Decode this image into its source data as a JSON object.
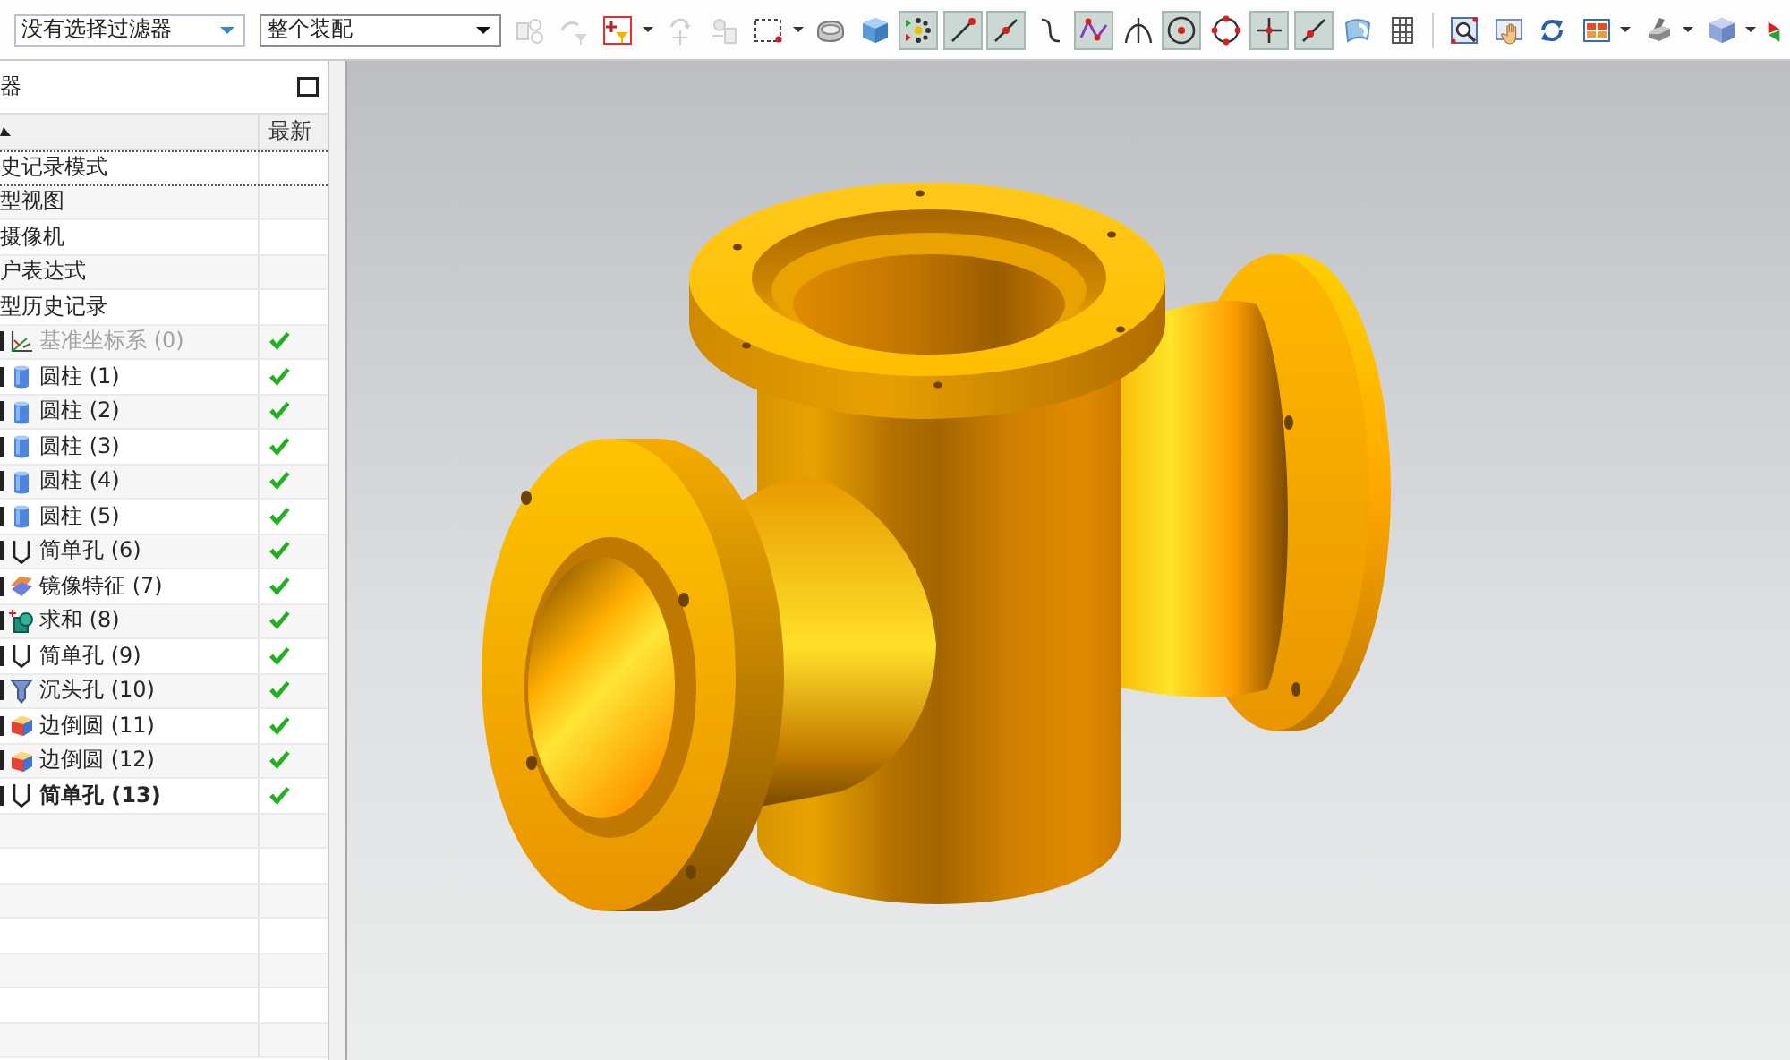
{
  "toolbar": {
    "filter_dropdown": {
      "value": "没有选择过滤器"
    },
    "scope_dropdown": {
      "value": "整个装配"
    },
    "groups": [
      {
        "buttons": [
          {
            "kind": "assembly",
            "on": false,
            "disabled": true,
            "menu": false
          },
          {
            "kind": "move_filter",
            "on": false,
            "disabled": true,
            "menu": false
          },
          {
            "kind": "add_filter",
            "on": false,
            "disabled": false,
            "menu": true
          },
          {
            "kind": "rotate_axis",
            "on": false,
            "disabled": true,
            "menu": false
          },
          {
            "kind": "component",
            "on": false,
            "disabled": true,
            "menu": false
          },
          {
            "kind": "box_select",
            "on": false,
            "disabled": false,
            "menu": true
          },
          {
            "kind": "solid",
            "on": false,
            "disabled": false,
            "menu": false
          },
          {
            "kind": "cube",
            "on": false,
            "disabled": false,
            "menu": false
          },
          {
            "kind": "snap_points",
            "on": true,
            "disabled": false,
            "menu": false
          },
          {
            "kind": "end_point",
            "on": true,
            "disabled": false,
            "menu": false
          },
          {
            "kind": "mid_point",
            "on": true,
            "disabled": false,
            "menu": false
          },
          {
            "kind": "curve",
            "on": false,
            "disabled": false,
            "menu": false
          },
          {
            "kind": "polyline",
            "on": true,
            "disabled": false,
            "menu": false
          },
          {
            "kind": "intersection",
            "on": false,
            "disabled": false,
            "menu": false
          },
          {
            "kind": "arc_center",
            "on": true,
            "disabled": false,
            "menu": false
          },
          {
            "kind": "quadrant",
            "on": false,
            "disabled": false,
            "menu": false
          },
          {
            "kind": "cross_point",
            "on": true,
            "disabled": false,
            "menu": false
          },
          {
            "kind": "point_on_line",
            "on": true,
            "disabled": false,
            "menu": false
          },
          {
            "kind": "surface",
            "on": false,
            "disabled": false,
            "menu": false
          },
          {
            "kind": "grid",
            "on": false,
            "disabled": false,
            "menu": false
          }
        ]
      },
      {
        "buttons": [
          {
            "kind": "zoom_area",
            "on": false,
            "disabled": false,
            "menu": false
          },
          {
            "kind": "pan",
            "on": false,
            "disabled": false,
            "menu": false
          },
          {
            "kind": "rotate",
            "on": false,
            "disabled": false,
            "menu": false
          },
          {
            "kind": "view_layout",
            "on": false,
            "disabled": false,
            "menu": true
          },
          {
            "kind": "render_style",
            "on": false,
            "disabled": false,
            "menu": true
          },
          {
            "kind": "view_cube",
            "on": false,
            "disabled": false,
            "menu": true
          },
          {
            "kind": "triad",
            "on": false,
            "disabled": false,
            "menu": false
          }
        ]
      }
    ]
  },
  "navigator": {
    "title": "器",
    "columns": [
      {
        "sorted": true
      },
      {
        "label": "最新",
        "sorted": false
      }
    ],
    "tree": [
      {
        "label": "史记录模式",
        "focused": true
      },
      {
        "label": "型视图",
        "focused": false
      },
      {
        "label": "摄像机",
        "focused": false
      },
      {
        "label": "户表达式",
        "focused": false
      },
      {
        "label": "型历史记录",
        "focused": false,
        "children": [
          {
            "kind": "datum_csys",
            "label": "基准坐标系 (0)",
            "dimmed": true,
            "current": false,
            "latest": true
          },
          {
            "kind": "cylinder",
            "label": "圆柱 (1)",
            "dimmed": false,
            "current": false,
            "latest": true
          },
          {
            "kind": "cylinder",
            "label": "圆柱 (2)",
            "dimmed": false,
            "current": false,
            "latest": true
          },
          {
            "kind": "cylinder",
            "label": "圆柱 (3)",
            "dimmed": false,
            "current": false,
            "latest": true
          },
          {
            "kind": "cylinder",
            "label": "圆柱 (4)",
            "dimmed": false,
            "current": false,
            "latest": true
          },
          {
            "kind": "cylinder",
            "label": "圆柱 (5)",
            "dimmed": false,
            "current": false,
            "latest": true
          },
          {
            "kind": "simple_hole",
            "label": "简单孔 (6)",
            "dimmed": false,
            "current": false,
            "latest": true
          },
          {
            "kind": "mirror",
            "label": "镜像特征 (7)",
            "dimmed": false,
            "current": false,
            "latest": true
          },
          {
            "kind": "unite",
            "label": "求和 (8)",
            "dimmed": false,
            "current": false,
            "latest": true
          },
          {
            "kind": "simple_hole",
            "label": "简单孔 (9)",
            "dimmed": false,
            "current": false,
            "latest": true
          },
          {
            "kind": "countersink_hole",
            "label": "沉头孔 (10)",
            "dimmed": false,
            "current": false,
            "latest": true
          },
          {
            "kind": "edge_blend",
            "label": "边倒圆 (11)",
            "dimmed": false,
            "current": false,
            "latest": true
          },
          {
            "kind": "edge_blend",
            "label": "边倒圆 (12)",
            "dimmed": false,
            "current": false,
            "latest": true
          },
          {
            "kind": "simple_hole",
            "label": "简单孔 (13)",
            "dimmed": false,
            "current": true,
            "latest": true
          }
        ]
      }
    ]
  }
}
